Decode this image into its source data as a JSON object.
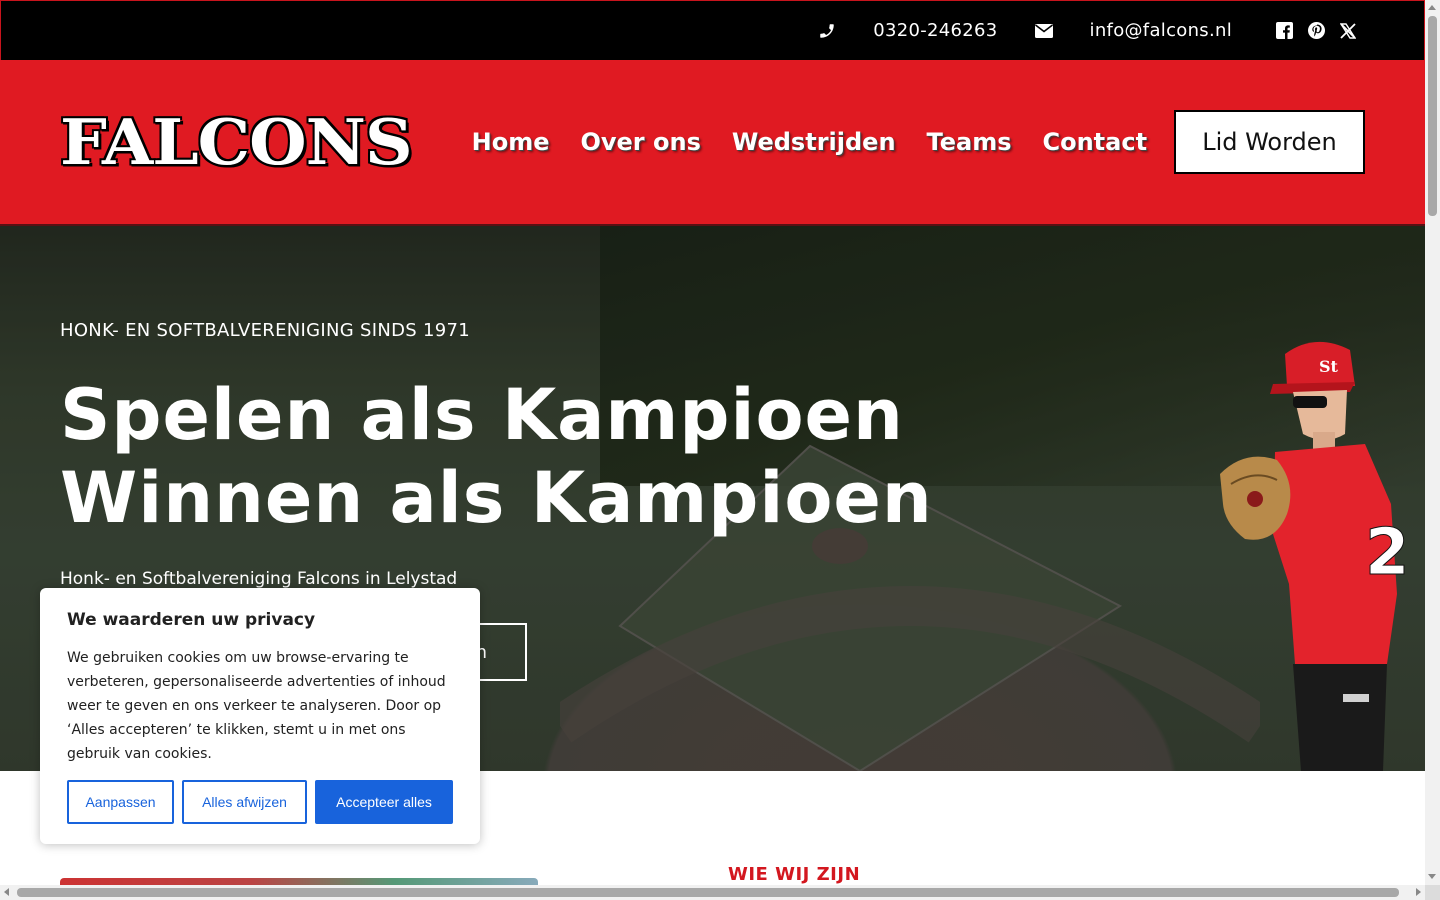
{
  "topbar": {
    "phone": "0320-246263",
    "email": "info@falcons.nl",
    "icons": [
      "phone-icon",
      "envelope-icon",
      "facebook-icon",
      "pinterest-icon",
      "x-icon"
    ]
  },
  "header": {
    "logo": "FALCONS",
    "nav": [
      "Home",
      "Over ons",
      "Wedstrijden",
      "Teams",
      "Contact"
    ],
    "cta": "Lid Worden",
    "accent": "#e01a22"
  },
  "hero": {
    "kicker": "HONK- EN SOFTBALVERENIGING SINDS 1971",
    "title_line1": "Spelen als Kampioen",
    "title_line2": "Winnen als Kampioen",
    "subtitle": "Honk- en Softbalvereniging Falcons in Lelystad",
    "button_visible_text": "n"
  },
  "section": {
    "label": "WIE WIJ ZIJN"
  },
  "cookie": {
    "title": "We waarderen uw privacy",
    "body": "We gebruiken cookies om uw browse-ervaring te verbeteren, gepersonaliseerde advertenties of inhoud weer te geven en ons verkeer te analyseren. Door op ‘Alles accepteren’ te klikken, stemt u in met ons gebruik van cookies.",
    "customize": "Aanpassen",
    "reject": "Alles afwijzen",
    "accept": "Accepteer alles",
    "button_color": "#1863dc"
  }
}
